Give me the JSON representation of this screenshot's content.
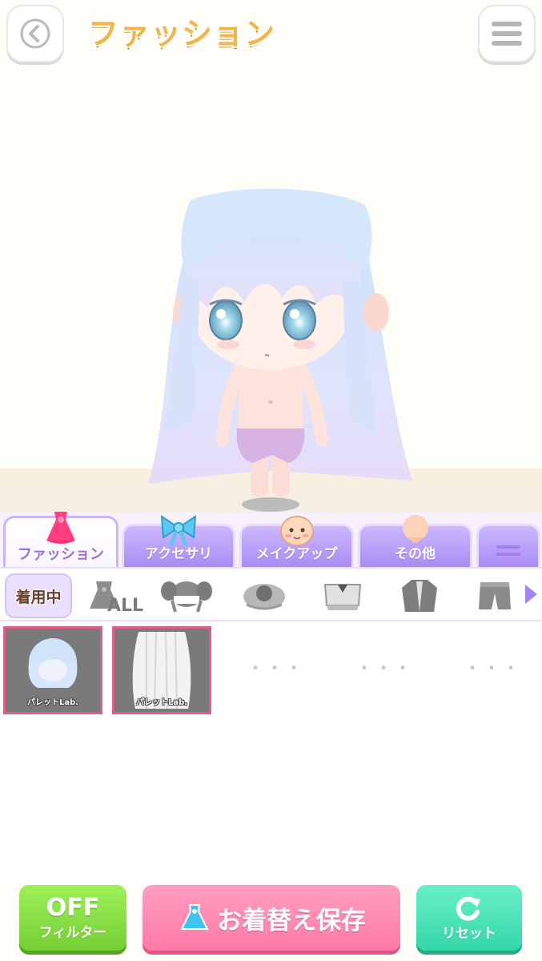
{
  "header": {
    "title": "ファッション"
  },
  "tabs": [
    {
      "label": "ファッション",
      "icon": "dress-icon",
      "active": true
    },
    {
      "label": "アクセサリ",
      "icon": "ribbon-icon",
      "active": false
    },
    {
      "label": "メイクアップ",
      "icon": "face-icon",
      "active": false
    },
    {
      "label": "その他",
      "icon": "character-icon",
      "active": false
    }
  ],
  "subfilters": {
    "wearing_label": "着用中",
    "all_label": "ALL",
    "items": [
      "hair-front-icon",
      "hair-pigtails-icon",
      "hair-bun-icon",
      "top-icon",
      "jacket-icon",
      "pants-icon"
    ]
  },
  "grid": {
    "items": [
      {
        "brand": "パレットLab.",
        "type": "short-hair",
        "selected": true
      },
      {
        "brand": "パレットLab.",
        "type": "long-hair",
        "selected": true
      }
    ],
    "placeholder": "・・・"
  },
  "buttons": {
    "filter_state": "OFF",
    "filter_label": "フィルター",
    "save_label": "お着替え保存",
    "reset_label": "リセット"
  },
  "colors": {
    "accent_purple": "#a98bf3",
    "selected_border": "#e25b86",
    "save_pink": "#ff7aa6",
    "filter_green": "#74cf34",
    "reset_teal": "#33d7a8",
    "title_orange": "#f3b548"
  }
}
